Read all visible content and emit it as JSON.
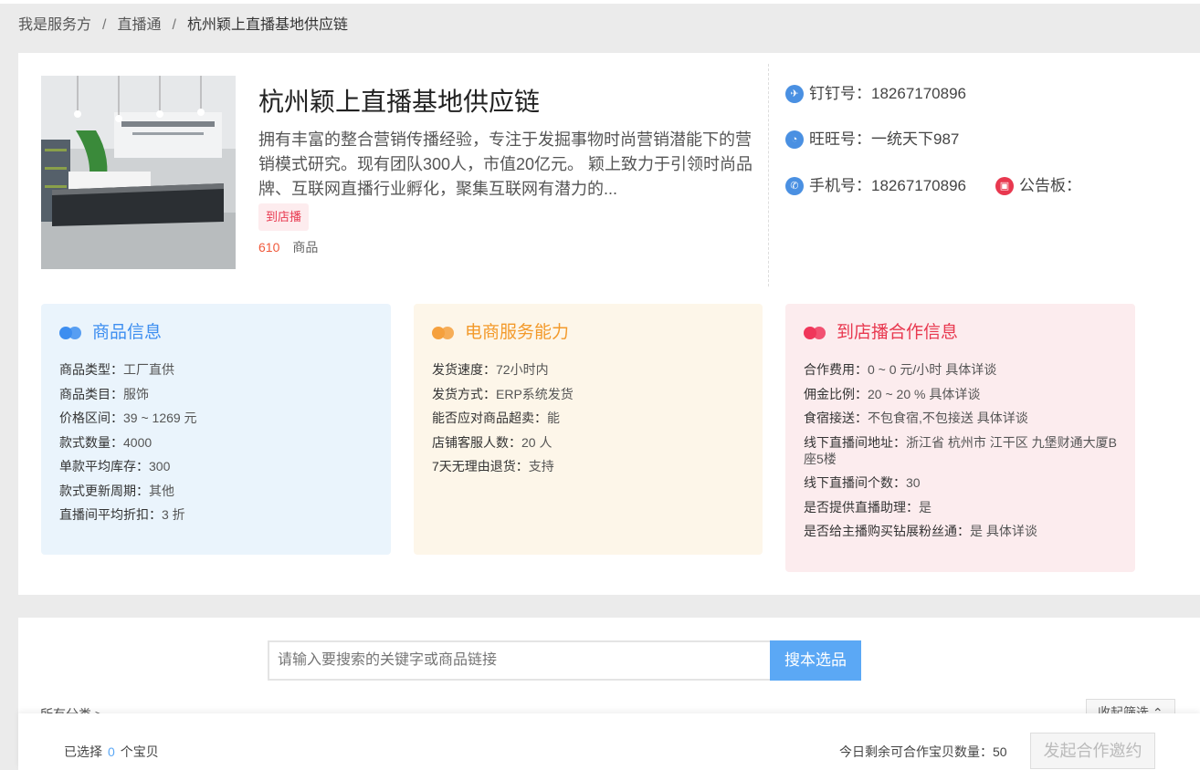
{
  "breadcrumb": {
    "item1": "我是服务方",
    "item2": "直播通",
    "current": "杭州颖上直播基地供应链",
    "separator": "/"
  },
  "shop": {
    "name": "杭州颖上直播基地供应链",
    "description": "拥有丰富的整合营销传播经验，专注于发掘事物时尚营销潜能下的营销模式研究。现有团队300人，市值20亿元。 颖上致力于引领时尚品牌、互联网直播行业孵化，聚集互联网有潜力的...",
    "tag": "到店播",
    "product_count": "610",
    "product_label": "商品"
  },
  "contacts": {
    "dingtalk": "钉钉号：18267170896",
    "wangwang": "旺旺号：一统天下987",
    "phone": "手机号：18267170896",
    "notice": "公告板："
  },
  "panels": {
    "goods": {
      "title": "商品信息",
      "rows": [
        {
          "k": "商品类型：",
          "v": "工厂直供"
        },
        {
          "k": "商品类目：",
          "v": "服饰"
        },
        {
          "k": "价格区间：",
          "v": "39 ~ 1269 元"
        },
        {
          "k": "款式数量：",
          "v": "4000"
        },
        {
          "k": "单款平均库存：",
          "v": "300"
        },
        {
          "k": "款式更新周期：",
          "v": "其他"
        },
        {
          "k": "直播间平均折扣：",
          "v": "3 折"
        }
      ]
    },
    "service": {
      "title": "电商服务能力",
      "rows": [
        {
          "k": "发货速度：",
          "v": "72小时内"
        },
        {
          "k": "发货方式：",
          "v": "ERP系统发货"
        },
        {
          "k": "能否应对商品超卖：",
          "v": "能"
        },
        {
          "k": "店铺客服人数：",
          "v": "20 人"
        },
        {
          "k": "7天无理由退货：",
          "v": "支持"
        }
      ]
    },
    "coop": {
      "title": "到店播合作信息",
      "rows": [
        {
          "k": "合作费用：",
          "v": "0 ~ 0 元/小时 具体详谈"
        },
        {
          "k": "佣金比例：",
          "v": "20 ~ 20 % 具体详谈"
        },
        {
          "k": "食宿接送：",
          "v": "不包食宿,不包接送 具体详谈"
        },
        {
          "k": "线下直播间地址：",
          "v": "浙江省 杭州市 江干区 九堡财通大厦B座5楼"
        },
        {
          "k": "线下直播间个数：",
          "v": "30"
        },
        {
          "k": "是否提供直播助理：",
          "v": "是"
        },
        {
          "k": "是否给主播购买钻展粉丝通：",
          "v": "是 具体详谈"
        }
      ]
    }
  },
  "search": {
    "placeholder": "请输入要搜索的关键字或商品链接",
    "button": "搜本选品",
    "category": "所有分类 >",
    "collapse": "收起筛选 ⌃"
  },
  "footer": {
    "selected_prefix": "已选择",
    "selected_count": "0",
    "selected_suffix": "个宝贝",
    "remain": "今日剩余可合作宝贝数量：50",
    "invite_button": "发起合作邀约"
  },
  "colors": {
    "blue": "#3d8ef0",
    "orange": "#f39a2b",
    "red": "#e8384f"
  }
}
